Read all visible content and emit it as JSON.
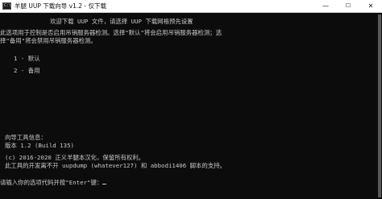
{
  "window": {
    "icon_text": "C:\\",
    "title": "羊腿 UUP 下载向导 v1.2 - 仅下载",
    "minimize_glyph": "—",
    "maximize_glyph": "☐",
    "close_glyph": "✕"
  },
  "console": {
    "header": "欢迎下载 UUP 文件，请选择 UUP 下载网格预先设置",
    "notice_1": "此选项用于控制是否启用吊销服务器检测。选择\"默认\"将会启用吊销服务器检测；选",
    "notice_2": "择\"备用\"将会禁用吊销服务器检测。",
    "option_1": "1 - 默认",
    "option_2": "2 - 备用",
    "info_title": "向导工具信息：",
    "version": "版本 1.2 (Build 135)",
    "copyright": "(c) 2016-2020 正义羊腿本汉化，保留所有权利。",
    "developers": "此工具的开发离不开 uupdump (whatever127) 和 abbodi1406 脚本的支持。",
    "prompt": "请输入你的选项代码并按\"Enter\"键："
  },
  "colors": {
    "console_bg": "#0c0c0c",
    "console_text": "#c8c8c8",
    "titlebar_bg": "#ffffff"
  }
}
